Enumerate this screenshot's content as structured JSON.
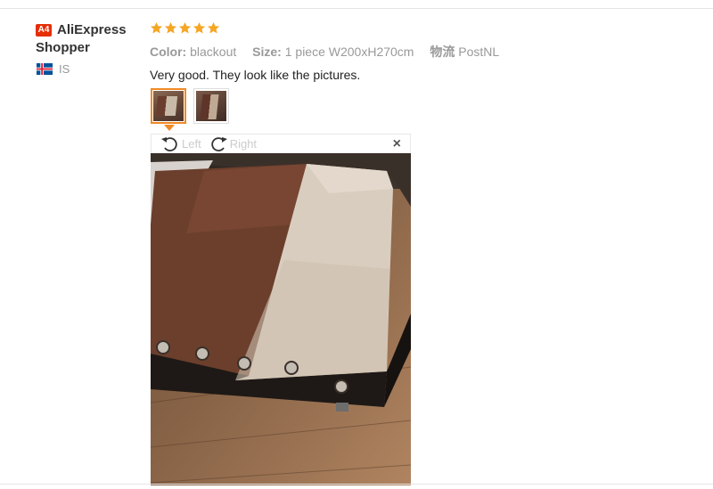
{
  "reviewer": {
    "badge": "A4",
    "name": "AliExpress Shopper",
    "country_code": "IS",
    "flag": "iceland-flag"
  },
  "review": {
    "rating": 5,
    "rating_max": 5,
    "color_label": "Color:",
    "color_value": "blackout",
    "size_label": "Size:",
    "size_value": "1 piece W200xH270cm",
    "shipping_label": "物流",
    "shipping_value": "PostNL",
    "text": "Very good. They look like the pictures."
  },
  "thumbnails": [
    {
      "name": "review-photo-1",
      "active": true
    },
    {
      "name": "review-photo-2",
      "active": false
    }
  ],
  "viewer": {
    "rotate_left_label": "Left",
    "rotate_right_label": "Right",
    "close_glyph": "×"
  },
  "colors": {
    "star": "#f5a623",
    "badge": "#e62e04",
    "active_thumb": "#f08a24"
  }
}
